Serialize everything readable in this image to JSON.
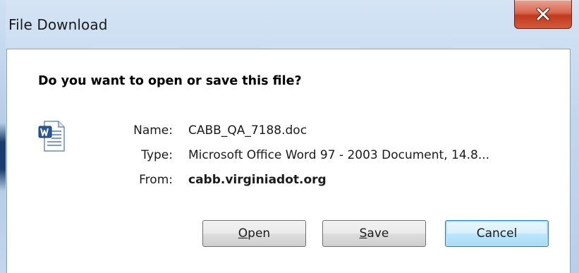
{
  "window": {
    "title": "File Download",
    "close_icon": "close-icon"
  },
  "dialog": {
    "question": "Do you want to open or save this file?",
    "file_icon": "word-document-icon",
    "name_label": "Name:",
    "name_value": "CABB_QA_7188.doc",
    "type_label": "Type:",
    "type_value": "Microsoft Office Word 97 - 2003 Document, 14.8...",
    "from_label": "From:",
    "from_value": "cabb.virginiadot.org"
  },
  "buttons": {
    "open_mnemonic": "O",
    "open_rest": "pen",
    "save_mnemonic": "S",
    "save_rest": "ave",
    "cancel_label": "Cancel"
  },
  "colors": {
    "close_button": "#c0391f",
    "default_button_border": "#3c7fb1"
  }
}
